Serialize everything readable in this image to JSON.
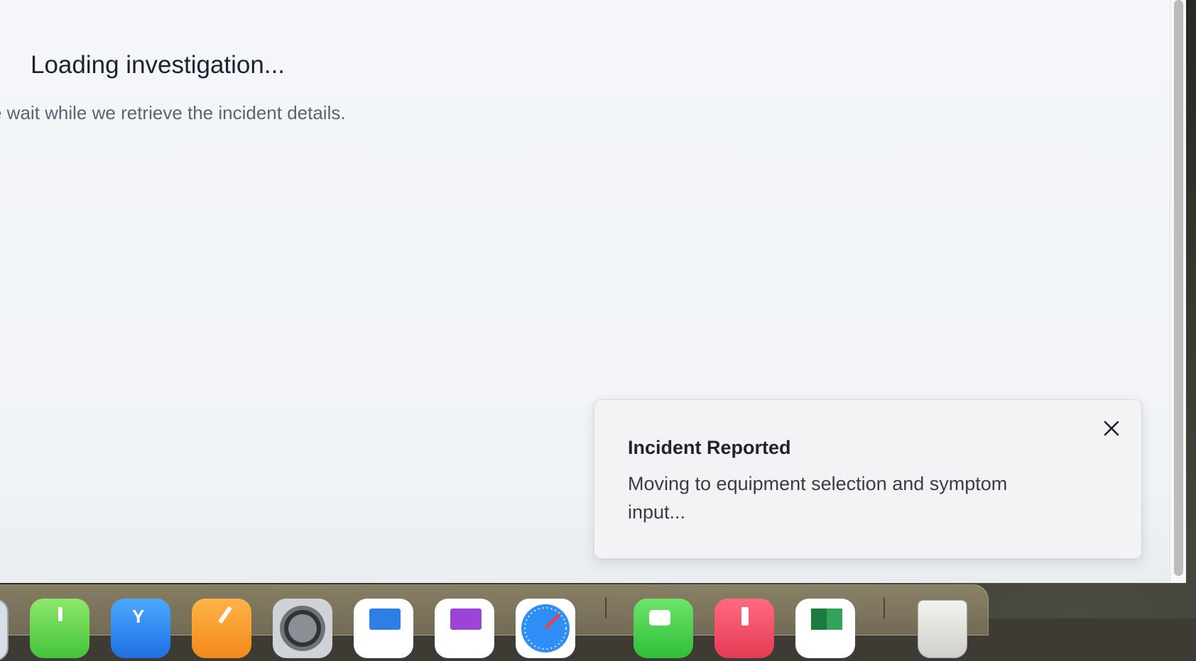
{
  "main": {
    "loading_title": "Loading investigation...",
    "loading_subtitle": "e wait while we retrieve the incident details."
  },
  "toast": {
    "title": "Incident Reported",
    "message": "Moving to equipment selection and symptom input...",
    "close_icon": "close-icon"
  },
  "dock": {
    "icons": [
      "partial-app-icon",
      "numbers-icon",
      "xcode-icon",
      "pages-icon",
      "system-settings-icon",
      "keynote-icon",
      "onenote-icon",
      "safari-icon",
      "facetime-icon",
      "music-icon",
      "excel-icon",
      "trash-icon"
    ]
  }
}
